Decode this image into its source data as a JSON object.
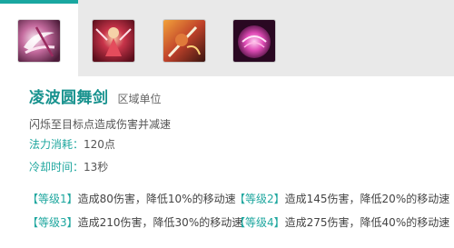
{
  "tabs": [
    {
      "icon": "swirl-sword-skill-icon",
      "active": true
    },
    {
      "icon": "red-warrior-skill-icon",
      "active": false
    },
    {
      "icon": "sword-slash-skill-icon",
      "active": false
    },
    {
      "icon": "pink-orb-skill-icon",
      "active": false
    }
  ],
  "colors": {
    "accent": "#19a7a0",
    "title": "#17928e"
  },
  "skill": {
    "name": "凌波圆舞剑",
    "type": "区域单位",
    "description": "闪烁至目标点造成伤害并减速",
    "cost_label": "法力消耗：",
    "cost_value": "120点",
    "cooldown_label": "冷却时间：",
    "cooldown_value": "13秒"
  },
  "levels": [
    {
      "tag": "【等级1】",
      "text": "造成80伤害，降低10%的移动速"
    },
    {
      "tag": "【等级2】",
      "text": "造成145伤害，降低20%的移动速"
    },
    {
      "tag": "【等级3】",
      "text": "造成210伤害，降低30%的移动速"
    },
    {
      "tag": "【等级4】",
      "text": "造成275伤害，降低40%的移动速"
    }
  ]
}
